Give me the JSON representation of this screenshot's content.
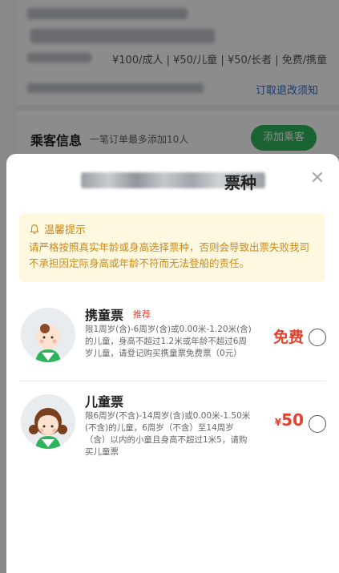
{
  "background": {
    "price_line": "¥100/成人 | ¥50/儿童 | ¥50/长者 | 免费/携童",
    "refund_link": "订取退改须知",
    "passenger": {
      "title": "乘客信息",
      "subtitle": "一笔订单最多添加10人",
      "add_button": "添加乘客"
    }
  },
  "sheet": {
    "title_tail": "票种",
    "tip": {
      "heading": "温馨提示",
      "text": "请严格按照真实年龄或身高选择票种，否则会导致出票失败我司不承担因定际身高或年龄不符而无法登船的责任。"
    },
    "tickets": [
      {
        "name": "携童票",
        "tag": "推荐",
        "desc": "限1周岁(含)-6周岁(含)或0.00米-1.20米(含)的儿童，身高不超过1.2米或年龄不超过6周岁儿童，请登记购买携童票免费票（0元）",
        "price_label": "免费"
      },
      {
        "name": "儿童票",
        "desc": "限6周岁(不含)-14周岁(含)或0.00米-1.50米(不含)的儿童，6周岁（不含）至14周岁（含）以内的小童且身高不超过1米5，请购买儿童票",
        "currency": "¥",
        "price": "50"
      }
    ]
  },
  "colors": {
    "accent_red": "#e5412d",
    "tip_text": "#c98a1a",
    "green": "#2fb35a",
    "link_blue": "#2b6fd6"
  }
}
